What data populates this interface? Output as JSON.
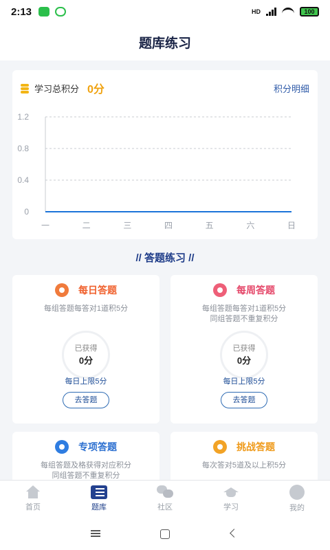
{
  "status": {
    "time": "2:13",
    "battery": "100",
    "network": "HD"
  },
  "header": {
    "title": "题库练习"
  },
  "points": {
    "label": "学习总积分",
    "value": "0分",
    "detail_link": "积分明细"
  },
  "chart_data": {
    "type": "line",
    "categories": [
      "一",
      "二",
      "三",
      "四",
      "五",
      "六",
      "日"
    ],
    "values": [
      0,
      0,
      0,
      0,
      0,
      0,
      0
    ],
    "y_ticks": [
      "0",
      "0.4",
      "0.8",
      "1.2"
    ],
    "ylim": [
      0,
      1.2
    ],
    "grid": true,
    "line_color": "#1a73d9"
  },
  "section": {
    "title": "// 答题练习 //"
  },
  "cards": [
    {
      "title": "每日答题",
      "title_color": "#f0622f",
      "icon_color": "#f07b3c",
      "icon": "pencil-icon",
      "desc": [
        "每组答题每答对1道积5分"
      ],
      "earned_label": "已获得",
      "earned_value": "0分",
      "limit": "每日上限5分",
      "button": "去答题"
    },
    {
      "title": "每周答题",
      "title_color": "#e5486a",
      "icon_color": "#ee5f78",
      "icon": "calendar-icon",
      "desc": [
        "每组答题每答对1道积5分",
        "同组答题不重复积分"
      ],
      "earned_label": "已获得",
      "earned_value": "0分",
      "limit": "每日上限5分",
      "button": "去答题"
    },
    {
      "title": "专项答题",
      "title_color": "#2b6fd0",
      "icon_color": "#2f7de1",
      "icon": "target-icon",
      "desc": [
        "每组答题及格获得对应积分",
        "同组答题不重复积分"
      ]
    },
    {
      "title": "挑战答题",
      "title_color": "#ef9a1a",
      "icon_color": "#f2a326",
      "icon": "shield-icon",
      "desc": [
        "每次答对5道及以上积5分"
      ]
    }
  ],
  "tabbar": [
    {
      "label": "首页",
      "icon": "home-icon",
      "active": false
    },
    {
      "label": "题库",
      "icon": "question-bank-icon",
      "active": true
    },
    {
      "label": "社区",
      "icon": "chat-icon",
      "active": false
    },
    {
      "label": "学习",
      "icon": "graduation-cap-icon",
      "active": false
    },
    {
      "label": "我的",
      "icon": "profile-icon",
      "active": false
    }
  ]
}
